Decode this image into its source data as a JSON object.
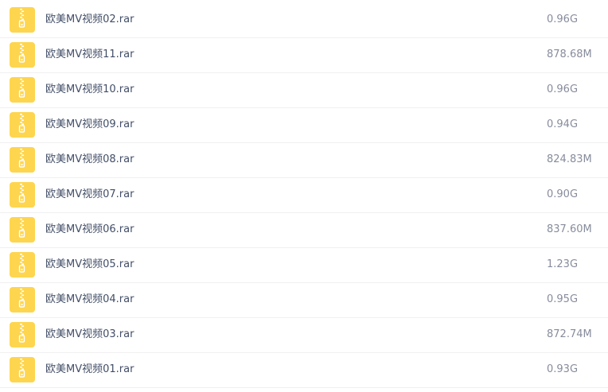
{
  "files": [
    {
      "name": "欧美MV视频02.rar",
      "size": "0.96G",
      "icon": "zip-archive-icon"
    },
    {
      "name": "欧美MV视频11.rar",
      "size": "878.68M",
      "icon": "zip-archive-icon"
    },
    {
      "name": "欧美MV视频10.rar",
      "size": "0.96G",
      "icon": "zip-archive-icon"
    },
    {
      "name": "欧美MV视频09.rar",
      "size": "0.94G",
      "icon": "zip-archive-icon"
    },
    {
      "name": "欧美MV视频08.rar",
      "size": "824.83M",
      "icon": "zip-archive-icon"
    },
    {
      "name": "欧美MV视频07.rar",
      "size": "0.90G",
      "icon": "zip-archive-icon"
    },
    {
      "name": "欧美MV视频06.rar",
      "size": "837.60M",
      "icon": "zip-archive-icon"
    },
    {
      "name": "欧美MV视频05.rar",
      "size": "1.23G",
      "icon": "zip-archive-icon"
    },
    {
      "name": "欧美MV视频04.rar",
      "size": "0.95G",
      "icon": "zip-archive-icon"
    },
    {
      "name": "欧美MV视频03.rar",
      "size": "872.74M",
      "icon": "zip-archive-icon"
    },
    {
      "name": "欧美MV视频01.rar",
      "size": "0.93G",
      "icon": "zip-archive-icon"
    }
  ],
  "colors": {
    "icon_fill": "#fed54e",
    "icon_zipper": "#ffffff",
    "name_text": "#424e67",
    "size_text": "#878c9c",
    "row_divider": "#f0f0f1"
  }
}
